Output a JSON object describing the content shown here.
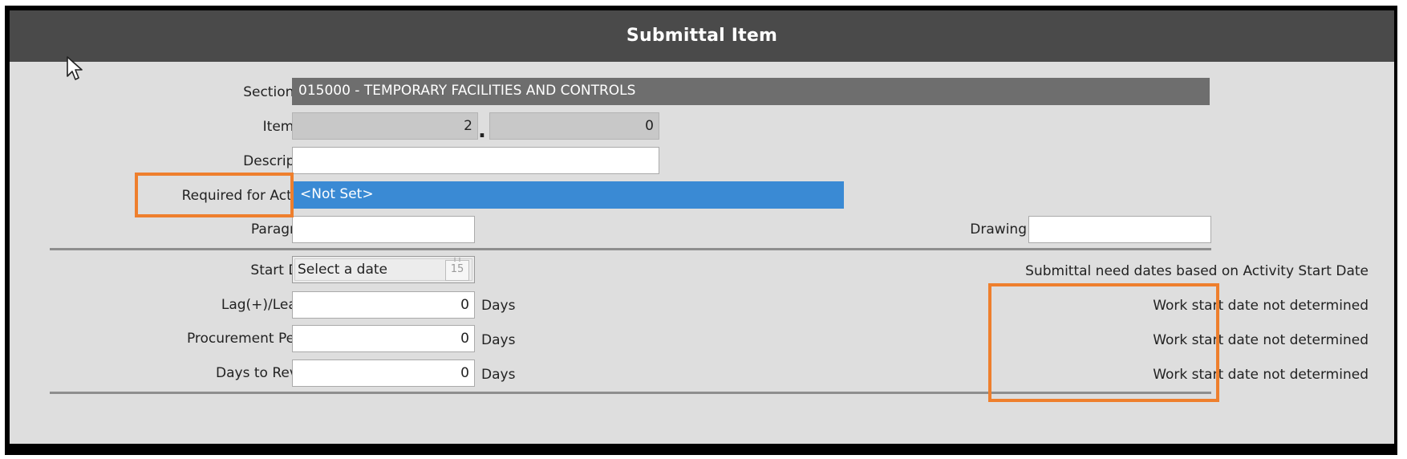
{
  "dialog": {
    "title": "Submittal Item"
  },
  "form": {
    "section_no": {
      "label": "Section No.",
      "value": "015000 - TEMPORARY FACILITIES AND CONTROLS"
    },
    "item_no": {
      "label": "Item No.",
      "major": "2",
      "separator": ".",
      "minor": "0"
    },
    "description": {
      "label": "Description",
      "value": ""
    },
    "required_for_activity": {
      "label": "Required for Activity",
      "value": "<Not Set>"
    },
    "paragraph": {
      "label": "Paragraph",
      "value": ""
    },
    "drawing": {
      "label": "Drawing",
      "value": ""
    },
    "start_date": {
      "label": "Start Date",
      "placeholder": "Select a date",
      "calendar_day": "15"
    },
    "need_dates_note": "Submittal need dates based on Activity Start Date",
    "lag_lead": {
      "label": "Lag(+)/Lead(-)",
      "value": "0",
      "unit": "Days",
      "status": "Work start date not determined"
    },
    "procurement_period": {
      "label": "Procurement Period",
      "value": "0",
      "unit": "Days",
      "status": "Work start date not determined"
    },
    "days_to_review": {
      "label": "Days to Review",
      "value": "0",
      "unit": "Days",
      "status": "Work start date not determined"
    }
  },
  "colors": {
    "titlebar": "#4a4a4a",
    "panel": "#dedede",
    "selection": "#3a8ad4",
    "highlight": "#ee7f2d"
  },
  "icons": {
    "cursor": "mouse-pointer-icon",
    "calendar": "calendar-icon"
  }
}
